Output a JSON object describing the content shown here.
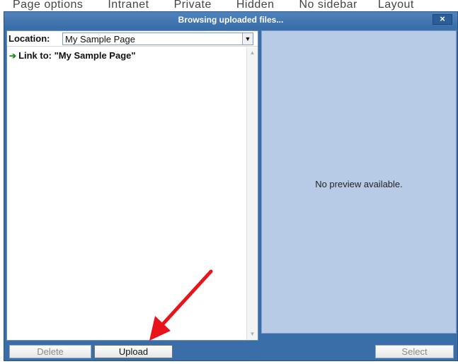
{
  "background": {
    "toolbar_items": [
      "Page options",
      "Intranet",
      "Private",
      "Hidden",
      "No sidebar",
      "Layout"
    ]
  },
  "dialog": {
    "title": "Browsing uploaded files...",
    "close_label": "×"
  },
  "location": {
    "label": "Location:",
    "value": "My Sample Page"
  },
  "file_list": {
    "items": [
      {
        "label": "Link to: \"My Sample Page\""
      }
    ]
  },
  "preview": {
    "text": "No preview available."
  },
  "buttons": {
    "delete": "Delete",
    "upload": "Upload",
    "select": "Select"
  },
  "icons": {
    "link_arrow": "right-arrow-icon",
    "dropdown": "chevron-down-icon",
    "close": "close-icon"
  },
  "colors": {
    "dialog_blue": "#3a6ea8",
    "preview_bg": "#b8cbe6",
    "annotation_red": "#e8141a",
    "link_arrow": "#1a8a1a"
  }
}
